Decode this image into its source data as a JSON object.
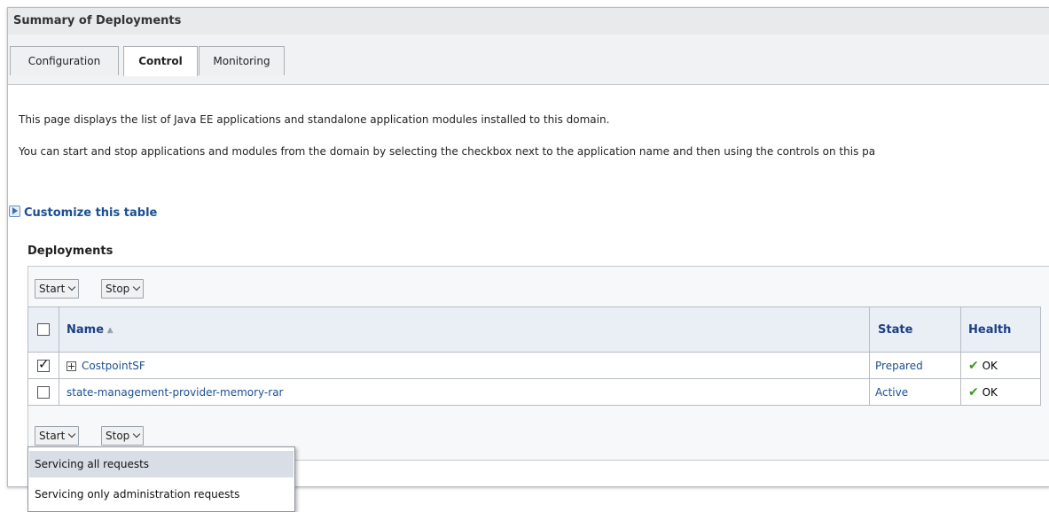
{
  "panel": {
    "title": "Summary of Deployments"
  },
  "tabs": [
    {
      "label": "Configuration",
      "active": false
    },
    {
      "label": "Control",
      "active": true
    },
    {
      "label": "Monitoring",
      "active": false
    }
  ],
  "description": {
    "line1": "This page displays the list of Java EE applications and standalone application modules installed to this domain.",
    "line2": "You can start and stop applications and modules from the domain by selecting the checkbox next to the application name and then using the controls on this pa"
  },
  "customize_link": "Customize this table",
  "deployments": {
    "title": "Deployments",
    "start_label": "Start",
    "stop_label": "Stop",
    "columns": {
      "name": "Name",
      "state": "State",
      "health": "Health"
    },
    "rows": [
      {
        "name": "CostpointSF",
        "expandable": true,
        "checked": true,
        "state": "Prepared",
        "health": "OK"
      },
      {
        "name": "state-management-provider-memory-rar",
        "expandable": false,
        "checked": false,
        "state": "Active",
        "health": "OK"
      }
    ]
  },
  "start_menu": {
    "items": [
      {
        "label": "Servicing all requests",
        "highlighted": true
      },
      {
        "label": "Servicing only administration requests",
        "highlighted": false
      }
    ]
  },
  "colors": {
    "link": "#1a4f92",
    "header_bg": "#eaeff6",
    "ok": "#2f9e1d",
    "menu_highlight": "#d8dde6"
  }
}
